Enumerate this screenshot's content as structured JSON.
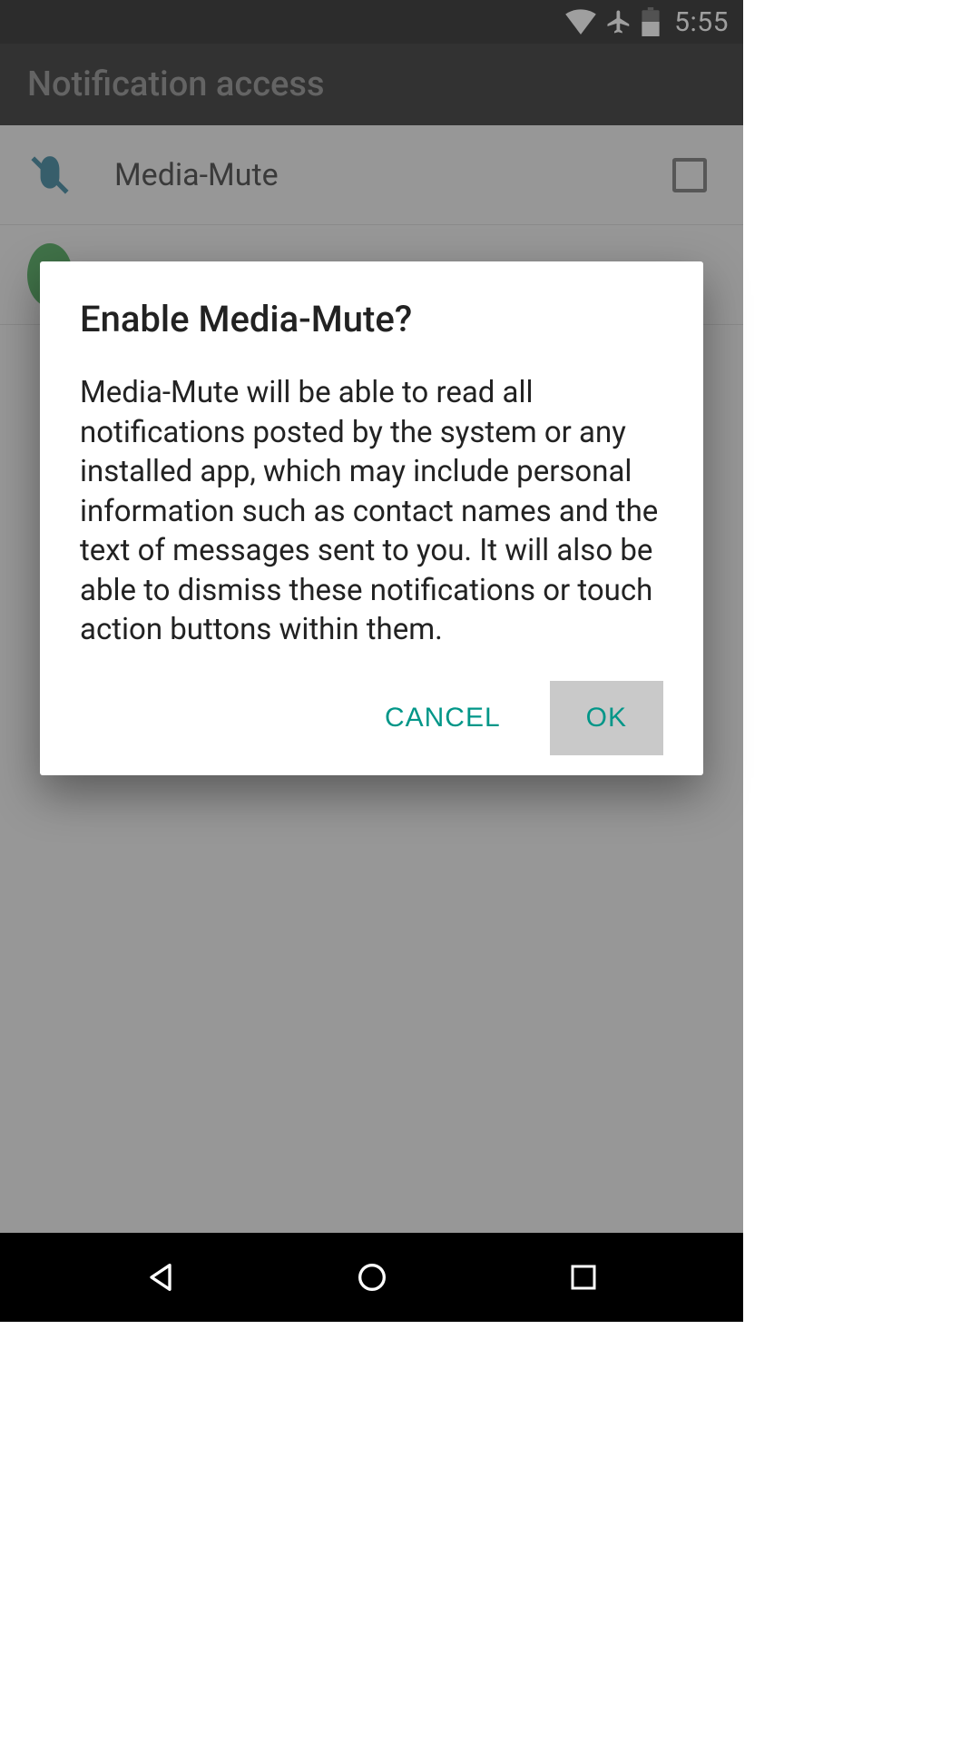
{
  "status": {
    "time": "5:55"
  },
  "appbar": {
    "title": "Notification access"
  },
  "list": {
    "items": [
      {
        "label": "Media-Mute"
      }
    ]
  },
  "dialog": {
    "title": "Enable Media-Mute?",
    "body": "Media-Mute will be able to read all notifications posted by the system or any installed app, which may include personal information such as contact names and the text of messages sent to you. It will also be able to dismiss these notifications or touch action buttons within them.",
    "cancel_label": "CANCEL",
    "ok_label": "OK"
  },
  "colors": {
    "accent": "#009688"
  }
}
